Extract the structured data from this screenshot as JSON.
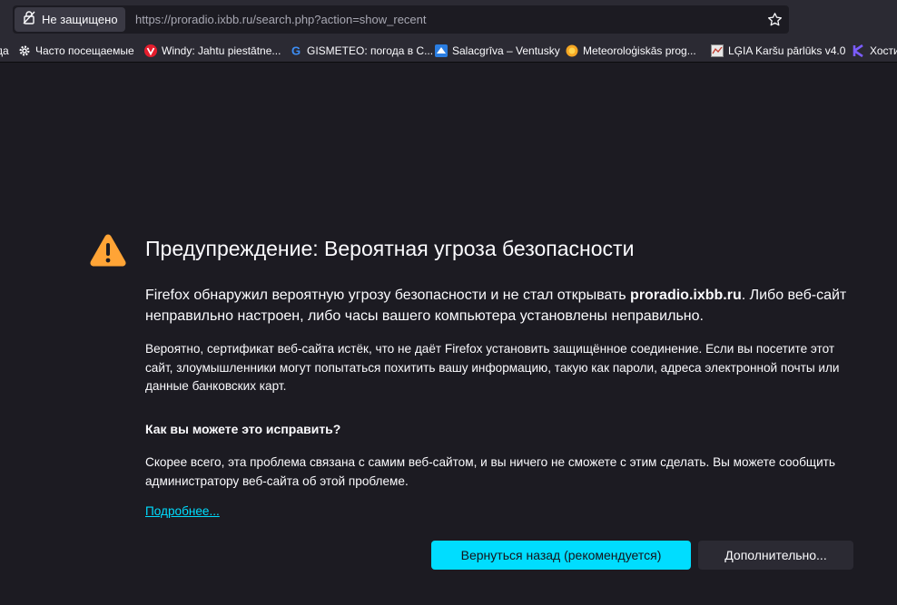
{
  "browser": {
    "identity_label": "Не защищено",
    "url": "https://proradio.ixbb.ru/search.php?action=show_recent",
    "bookmarks": [
      {
        "label": "да",
        "icon": "cut-off-favicon"
      },
      {
        "label": "Часто посещаемые",
        "icon": "gear-icon"
      },
      {
        "label": "Windy: Jahtu piestātne...",
        "icon": "windy-favicon"
      },
      {
        "label": "GISMETEO: погода в С...",
        "icon": "gismeteo-favicon"
      },
      {
        "label": "Salacgrīva – Ventusky",
        "icon": "ventusky-favicon"
      },
      {
        "label": "Meteoroloģiskās prog...",
        "icon": "sun-favicon"
      },
      {
        "label": "LĢIA Karšu pārlūks v4.0",
        "icon": "map-favicon"
      },
      {
        "label": "Хости",
        "icon": "k-favicon"
      }
    ]
  },
  "error_page": {
    "title": "Предупреждение: Вероятная угроза безопасности",
    "intro_before": "Firefox обнаружил вероятную угрозу безопасности и не стал открывать ",
    "intro_host": "proradio.ixbb.ru",
    "intro_after": ". Либо веб-сайт неправильно настроен, либо часы вашего компьютера установлены неправильно.",
    "description": "Вероятно, сертификат веб-сайта истёк, что не даёт Firefox установить защищённое соединение. Если вы посетите этот сайт, злоумышленники могут попытаться похитить вашу информацию, такую как пароли, адреса электронной почты или данные банковских карт.",
    "howto_heading": "Как вы можете это исправить?",
    "advice": "Скорее всего, эта проблема связана с самим веб-сайтом, и вы ничего не сможете с этим сделать. Вы можете сообщить администратору веб-сайта об этой проблеме.",
    "learn_more": "Подробнее...",
    "go_back_button": "Вернуться назад (рекомендуется)",
    "advanced_button": "Дополнительно..."
  },
  "colors": {
    "accent": "#00ddff",
    "warning": "#ffa436",
    "background": "#1c1b22",
    "toolbar": "#2b2a33"
  }
}
